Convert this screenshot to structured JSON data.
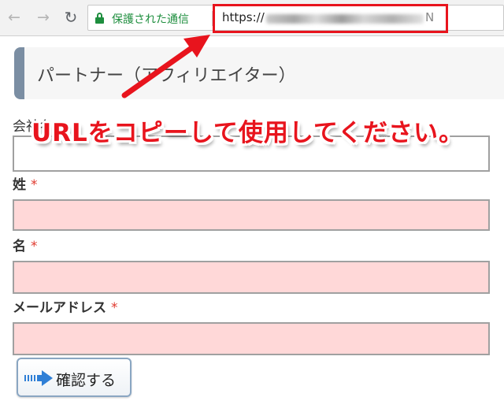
{
  "browser": {
    "back_icon": "arrow-left-icon",
    "forward_icon": "arrow-right-icon",
    "reload_icon": "reload-icon",
    "secure_label": "保護された通信",
    "url_prefix": "https://",
    "url_tail": "N",
    "accent_secure": "#1e8e3e"
  },
  "page": {
    "heading": "パートナー（アフィリエイター）",
    "fields": [
      {
        "label": "会社名",
        "required": false
      },
      {
        "label": "姓",
        "required": true
      },
      {
        "label": "名",
        "required": true
      },
      {
        "label": "メールアドレス",
        "required": true
      }
    ],
    "required_mark": "*",
    "confirm_button": "確認する"
  },
  "annotation": {
    "callout": "URLをコピーして使用してください。",
    "color": "#e8141d"
  }
}
